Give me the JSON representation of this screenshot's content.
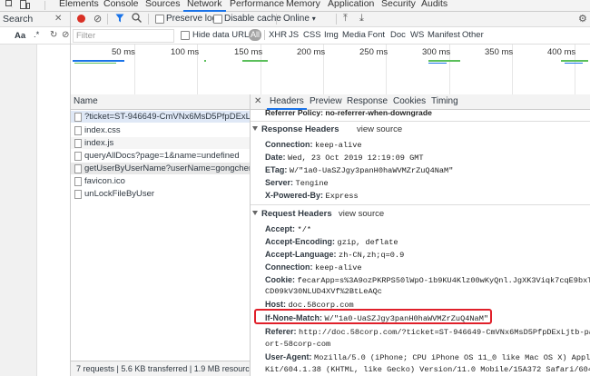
{
  "topbar": {
    "tabs": [
      "Elements",
      "Console",
      "Sources",
      "Network",
      "Performance",
      "Memory",
      "Application",
      "Security",
      "Audits"
    ],
    "active_tab": "Network"
  },
  "left_pane": {
    "search_label": "Search",
    "aa_label": "Aa",
    "regex_label": ".*"
  },
  "toolbar": {
    "preserve_log": "Preserve log",
    "disable_cache": "Disable cache",
    "throttle": "Online"
  },
  "filter": {
    "placeholder": "Filter",
    "hide_data_urls": "Hide data URLs",
    "types": [
      "All",
      "XHR",
      "JS",
      "CSS",
      "Img",
      "Media",
      "Font",
      "Doc",
      "WS",
      "Manifest",
      "Other"
    ]
  },
  "overview": {
    "ticks": [
      "50 ms",
      "100 ms",
      "150 ms",
      "200 ms",
      "250 ms",
      "300 ms",
      "350 ms",
      "400 ms"
    ]
  },
  "request_list": {
    "header": "Name",
    "rows": [
      "?ticket=ST-946649-CmVNx6MsD5PfpDExLjtb...",
      "index.css",
      "index.js",
      "queryAllDocs?page=1&name=undefined",
      "getUserByUserName?userName=gongchenghui",
      "favicon.ico",
      "unLockFileByUser"
    ],
    "status": "7 requests   |   5.6 KB transferred   |   1.9 MB resources"
  },
  "detail": {
    "tabs": [
      "Headers",
      "Preview",
      "Response",
      "Cookies",
      "Timing"
    ],
    "active_tab": "Headers",
    "referrer_policy": "Referrer Policy:  no-referrer-when-downgrade",
    "response_headers_title": "Response Headers",
    "view_source": "view source",
    "response_headers": [
      {
        "k": "Connection:",
        "v": "keep-alive"
      },
      {
        "k": "Date:",
        "v": "Wed, 23 Oct 2019 12:19:09 GMT"
      },
      {
        "k": "ETag:",
        "v": "W/\"1a0-UaSZJgy3panH0haWVMZrZuQ4NaM\""
      },
      {
        "k": "Server:",
        "v": "Tengine"
      },
      {
        "k": "X-Powered-By:",
        "v": "Express"
      }
    ],
    "request_headers_title": "Request Headers",
    "request_headers": [
      {
        "k": "Accept:",
        "v": "*/*"
      },
      {
        "k": "Accept-Encoding:",
        "v": "gzip, deflate"
      },
      {
        "k": "Accept-Language:",
        "v": "zh-CN,zh;q=0.9"
      },
      {
        "k": "Connection:",
        "v": "keep-alive"
      },
      {
        "k": "Cookie:",
        "v": "fecarApp=s%3A9ozPKRPS50lWpO-1b9KU4Klz00wKyQnl.JgXK3Viqk7cqE9bxTecv"
      },
      {
        "k": "",
        "v": "CD09kV30NLUD4XVf%2BtLeAQc"
      },
      {
        "k": "Host:",
        "v": "doc.58corp.com"
      },
      {
        "k": "If-None-Match:",
        "v": "W/\"1a0-UaSZJgy3panH0haWVMZrZuQ4NaM\""
      },
      {
        "k": "Referer:",
        "v": "http://doc.58corp.com/?ticket=ST-946649-CmVNx6MsD5PfpDExLjtb-passp"
      },
      {
        "k": "",
        "v": "ort-58corp-com"
      },
      {
        "k": "User-Agent:",
        "v": "Mozilla/5.0 (iPhone; CPU iPhone OS 11_0 like Mac OS X) AppleWeb"
      },
      {
        "k": "",
        "v": "Kit/604.1.38 (KHTML, like Gecko) Version/11.0 Mobile/15A372 Safari/604."
      }
    ]
  },
  "colors": {
    "accent": "#1a73e8",
    "record": "#d93025",
    "highlight_box": "#e0202a"
  }
}
